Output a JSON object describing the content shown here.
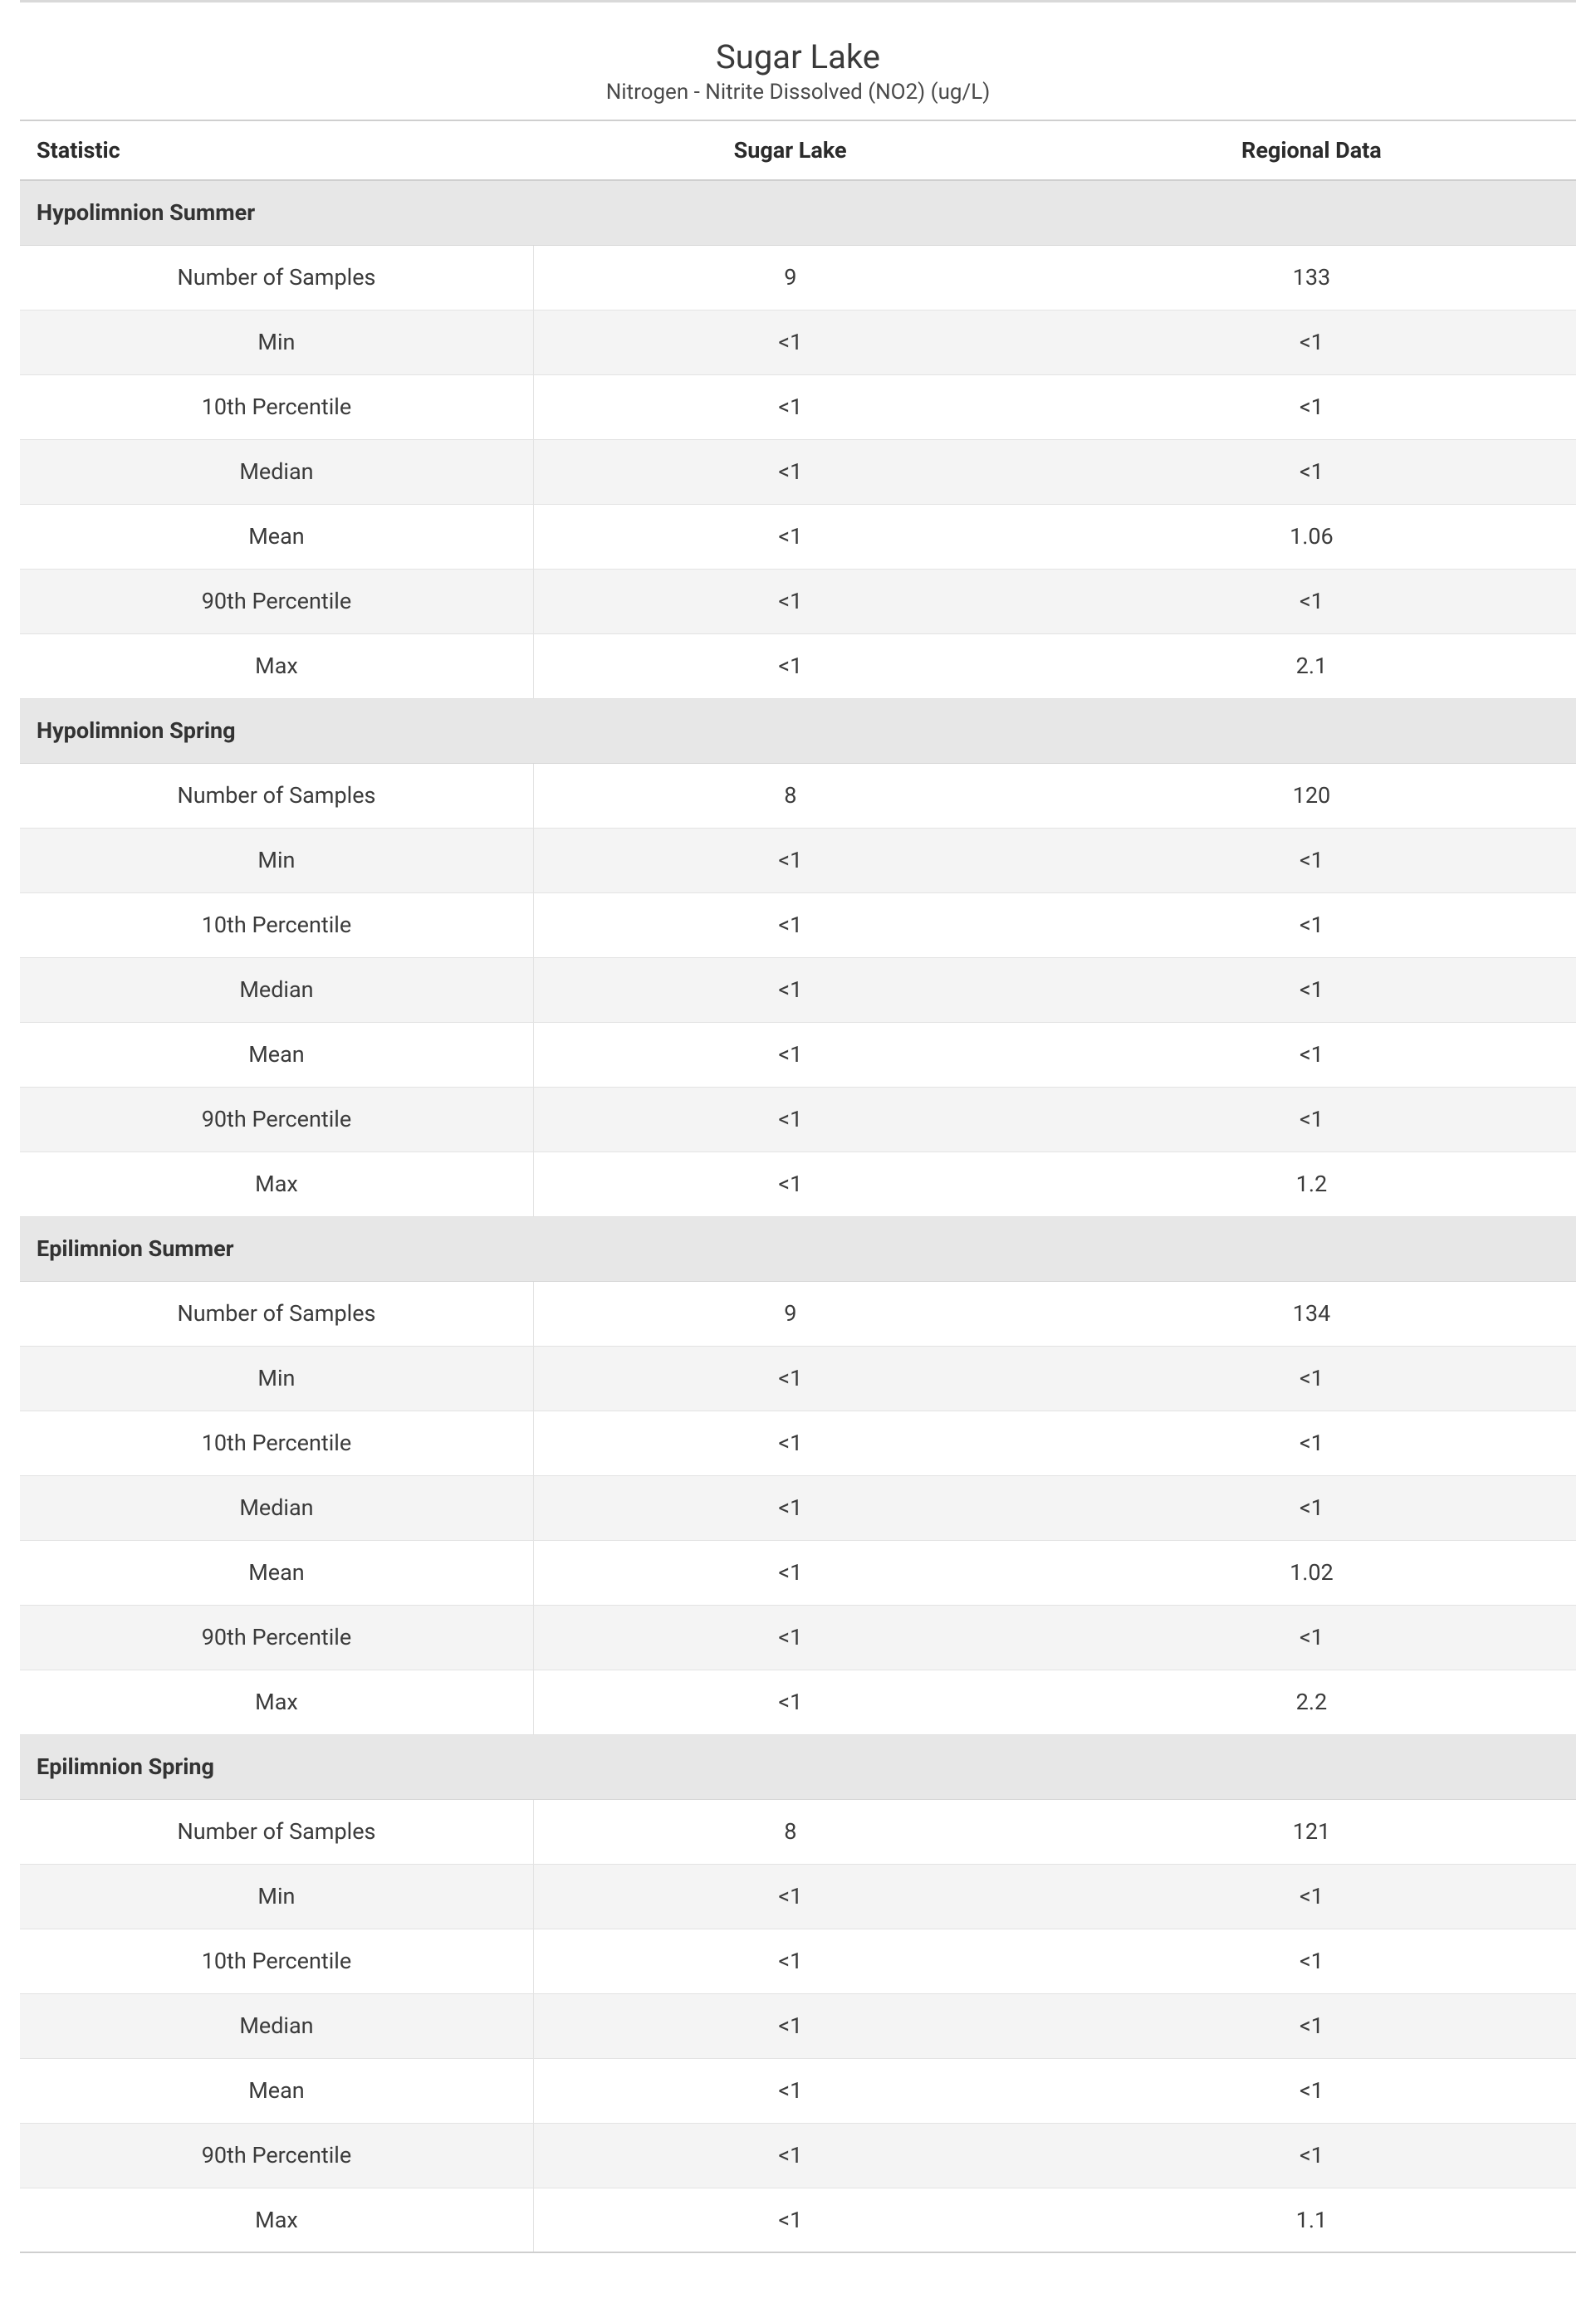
{
  "title": "Sugar Lake",
  "subtitle": "Nitrogen - Nitrite Dissolved (NO2) (ug/L)",
  "columns": {
    "statistic": "Statistic",
    "lake": "Sugar Lake",
    "regional": "Regional Data"
  },
  "stat_labels": [
    "Number of Samples",
    "Min",
    "10th Percentile",
    "Median",
    "Mean",
    "90th Percentile",
    "Max"
  ],
  "sections": [
    {
      "heading": "Hypolimnion Summer",
      "rows": [
        {
          "lake": "9",
          "regional": "133"
        },
        {
          "lake": "<1",
          "regional": "<1"
        },
        {
          "lake": "<1",
          "regional": "<1"
        },
        {
          "lake": "<1",
          "regional": "<1"
        },
        {
          "lake": "<1",
          "regional": "1.06"
        },
        {
          "lake": "<1",
          "regional": "<1"
        },
        {
          "lake": "<1",
          "regional": "2.1"
        }
      ]
    },
    {
      "heading": "Hypolimnion Spring",
      "rows": [
        {
          "lake": "8",
          "regional": "120"
        },
        {
          "lake": "<1",
          "regional": "<1"
        },
        {
          "lake": "<1",
          "regional": "<1"
        },
        {
          "lake": "<1",
          "regional": "<1"
        },
        {
          "lake": "<1",
          "regional": "<1"
        },
        {
          "lake": "<1",
          "regional": "<1"
        },
        {
          "lake": "<1",
          "regional": "1.2"
        }
      ]
    },
    {
      "heading": "Epilimnion Summer",
      "rows": [
        {
          "lake": "9",
          "regional": "134"
        },
        {
          "lake": "<1",
          "regional": "<1"
        },
        {
          "lake": "<1",
          "regional": "<1"
        },
        {
          "lake": "<1",
          "regional": "<1"
        },
        {
          "lake": "<1",
          "regional": "1.02"
        },
        {
          "lake": "<1",
          "regional": "<1"
        },
        {
          "lake": "<1",
          "regional": "2.2"
        }
      ]
    },
    {
      "heading": "Epilimnion Spring",
      "rows": [
        {
          "lake": "8",
          "regional": "121"
        },
        {
          "lake": "<1",
          "regional": "<1"
        },
        {
          "lake": "<1",
          "regional": "<1"
        },
        {
          "lake": "<1",
          "regional": "<1"
        },
        {
          "lake": "<1",
          "regional": "<1"
        },
        {
          "lake": "<1",
          "regional": "<1"
        },
        {
          "lake": "<1",
          "regional": "1.1"
        }
      ]
    }
  ]
}
